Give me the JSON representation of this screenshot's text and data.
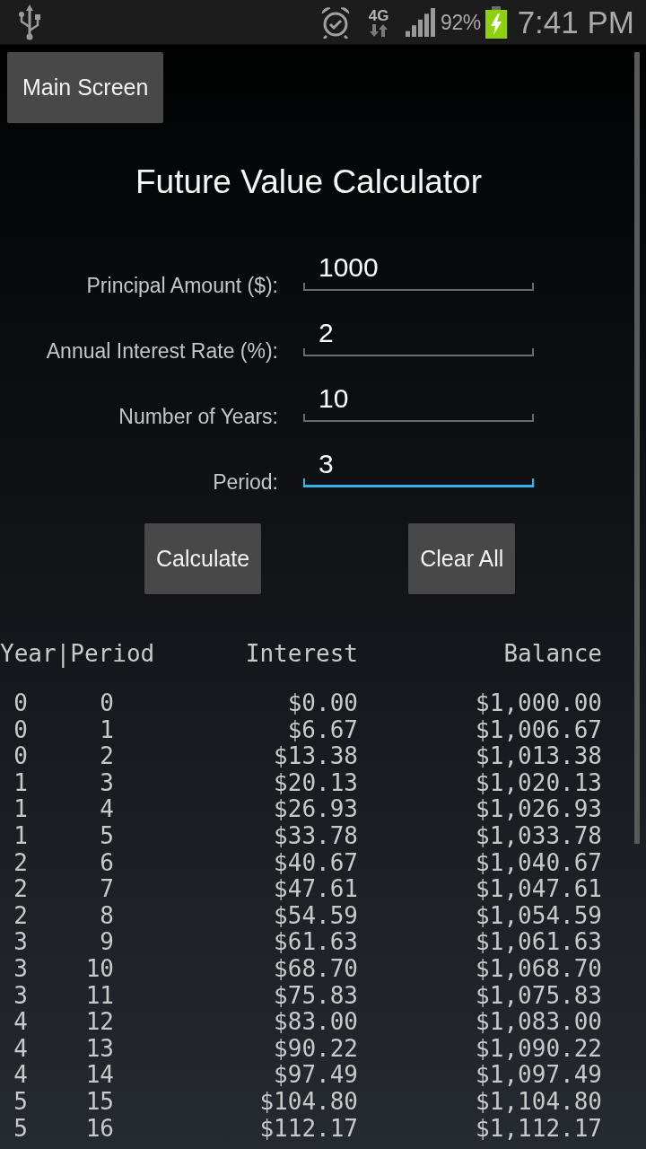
{
  "status_bar": {
    "network": "4G",
    "battery": "92%",
    "time": "7:41 PM"
  },
  "nav_button": "Main Screen",
  "title": "Future Value Calculator",
  "fields": [
    {
      "label": "Principal Amount ($):",
      "value": "1000",
      "focused": false
    },
    {
      "label": "Annual Interest Rate (%):",
      "value": "2",
      "focused": false
    },
    {
      "label": "Number of Years:",
      "value": "10",
      "focused": false
    },
    {
      "label": "Period:",
      "value": "3",
      "focused": true
    }
  ],
  "buttons": [
    "Calculate",
    "Clear All"
  ],
  "table": {
    "columns": [
      "Year|Period",
      "",
      "Interest",
      "Balance"
    ],
    "rows": [
      [
        "0",
        "0",
        "$0.00",
        "$1,000.00"
      ],
      [
        "0",
        "1",
        "$6.67",
        "$1,006.67"
      ],
      [
        "0",
        "2",
        "$13.38",
        "$1,013.38"
      ],
      [
        "1",
        "3",
        "$20.13",
        "$1,020.13"
      ],
      [
        "1",
        "4",
        "$26.93",
        "$1,026.93"
      ],
      [
        "1",
        "5",
        "$33.78",
        "$1,033.78"
      ],
      [
        "2",
        "6",
        "$40.67",
        "$1,040.67"
      ],
      [
        "2",
        "7",
        "$47.61",
        "$1,047.61"
      ],
      [
        "2",
        "8",
        "$54.59",
        "$1,054.59"
      ],
      [
        "3",
        "9",
        "$61.63",
        "$1,061.63"
      ],
      [
        "3",
        "10",
        "$68.70",
        "$1,068.70"
      ],
      [
        "3",
        "11",
        "$75.83",
        "$1,075.83"
      ],
      [
        "4",
        "12",
        "$83.00",
        "$1,083.00"
      ],
      [
        "4",
        "13",
        "$90.22",
        "$1,090.22"
      ],
      [
        "4",
        "14",
        "$97.49",
        "$1,097.49"
      ],
      [
        "5",
        "15",
        "$104.80",
        "$1,104.80"
      ],
      [
        "5",
        "16",
        "$112.17",
        "$1,112.17"
      ]
    ]
  }
}
